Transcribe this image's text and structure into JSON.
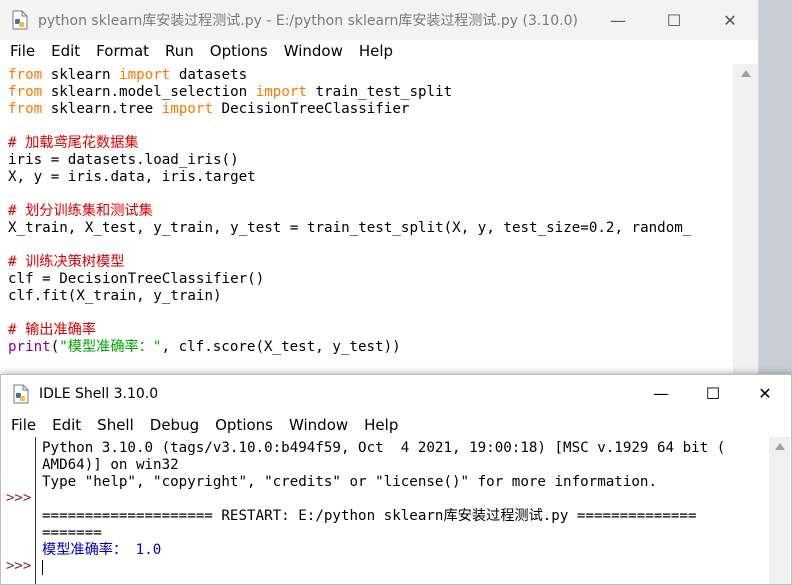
{
  "editor": {
    "title": "python sklearn库安装过程测试.py - E:/python sklearn库安装过程测试.py (3.10.0)",
    "menu": [
      "File",
      "Edit",
      "Format",
      "Run",
      "Options",
      "Window",
      "Help"
    ],
    "code": [
      [
        {
          "t": "from",
          "c": "kw"
        },
        {
          "t": " sklearn ",
          "c": ""
        },
        {
          "t": "import",
          "c": "kw"
        },
        {
          "t": " datasets",
          "c": ""
        }
      ],
      [
        {
          "t": "from",
          "c": "kw"
        },
        {
          "t": " sklearn.model_selection ",
          "c": ""
        },
        {
          "t": "import",
          "c": "kw"
        },
        {
          "t": " train_test_split",
          "c": ""
        }
      ],
      [
        {
          "t": "from",
          "c": "kw"
        },
        {
          "t": " sklearn.tree ",
          "c": ""
        },
        {
          "t": "import",
          "c": "kw"
        },
        {
          "t": " DecisionTreeClassifier",
          "c": ""
        }
      ],
      [],
      [
        {
          "t": "# 加载鸢尾花数据集",
          "c": "cm"
        }
      ],
      [
        {
          "t": "iris = datasets.load_iris()",
          "c": ""
        }
      ],
      [
        {
          "t": "X, y = iris.data, iris.target",
          "c": ""
        }
      ],
      [],
      [
        {
          "t": "# 划分训练集和测试集",
          "c": "cm"
        }
      ],
      [
        {
          "t": "X_train, X_test, y_train, y_test = train_test_split(X, y, test_size=0.2, random_",
          "c": ""
        }
      ],
      [],
      [
        {
          "t": "# 训练决策树模型",
          "c": "cm"
        }
      ],
      [
        {
          "t": "clf = DecisionTreeClassifier()",
          "c": ""
        }
      ],
      [
        {
          "t": "clf.fit(X_train, y_train)",
          "c": ""
        }
      ],
      [],
      [
        {
          "t": "# 输出准确率",
          "c": "cm"
        }
      ],
      [
        {
          "t": "print",
          "c": "bi"
        },
        {
          "t": "(",
          "c": ""
        },
        {
          "t": "\"模型准确率：\"",
          "c": "st"
        },
        {
          "t": ", clf.score(X_test, y_test))",
          "c": ""
        }
      ]
    ]
  },
  "shell": {
    "title": "IDLE Shell 3.10.0",
    "menu": [
      "File",
      "Edit",
      "Shell",
      "Debug",
      "Options",
      "Window",
      "Help"
    ],
    "prompts": [
      ">>>",
      ">>>"
    ],
    "lines": [
      {
        "t": "Python 3.10.0 (tags/v3.10.0:b494f59, Oct  4 2021, 19:00:18) [MSC v.1929 64 bit (",
        "c": ""
      },
      {
        "t": "AMD64)] on win32",
        "c": ""
      },
      {
        "t": "Type \"help\", \"copyright\", \"credits\" or \"license()\" for more information.",
        "c": ""
      },
      {
        "t": "",
        "c": ""
      },
      {
        "t": "==================== RESTART: E:/python sklearn库安装过程测试.py ==============",
        "c": ""
      },
      {
        "t": "=======",
        "c": ""
      },
      {
        "t": "模型准确率： 1.0",
        "c": "out-blue"
      }
    ]
  },
  "controls": {
    "minimize": "—",
    "maximize": "☐",
    "close": "✕"
  }
}
